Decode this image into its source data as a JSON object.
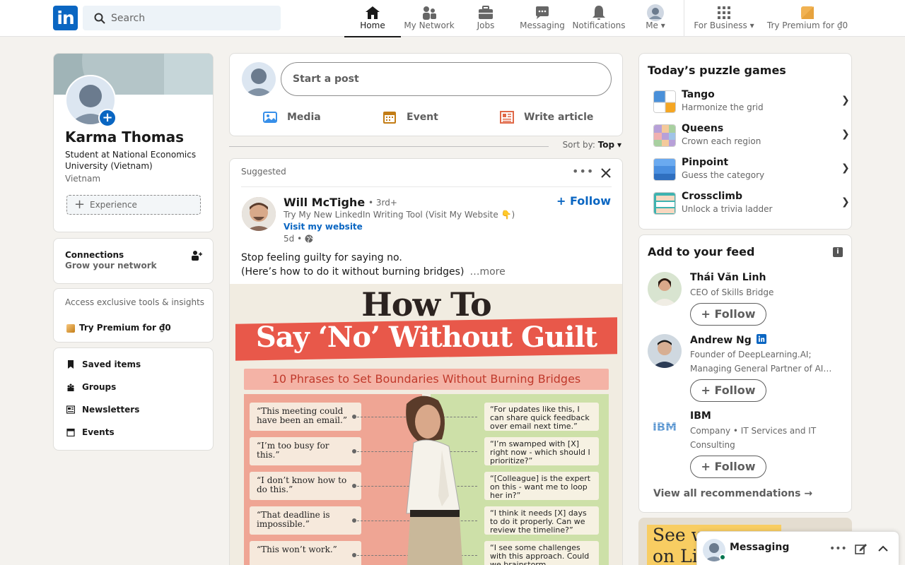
{
  "nav": {
    "logo": "in",
    "search_placeholder": "Search",
    "items": [
      {
        "label": "Home",
        "icon": "home-icon"
      },
      {
        "label": "My Network",
        "icon": "network-icon"
      },
      {
        "label": "Jobs",
        "icon": "briefcase-icon"
      },
      {
        "label": "Messaging",
        "icon": "chat-icon"
      },
      {
        "label": "Notifications",
        "icon": "bell-icon"
      },
      {
        "label": "Me",
        "icon": "avatar"
      },
      {
        "label": "For Business",
        "icon": "grid-icon"
      },
      {
        "label": "Try Premium for ₫0",
        "icon": "premium-icon"
      }
    ]
  },
  "profile": {
    "name": "Karma Thomas",
    "headline": "Student at National Economics University (Vietnam)",
    "location": "Vietnam",
    "experience_label": "Experience"
  },
  "connections": {
    "title": "Connections",
    "subtitle": "Grow your network"
  },
  "premium": {
    "text": "Access exclusive tools & insights",
    "link": "Try Premium for ₫0"
  },
  "left_menu": [
    {
      "label": "Saved items",
      "icon": "bookmark-icon"
    },
    {
      "label": "Groups",
      "icon": "groups-icon"
    },
    {
      "label": "Newsletters",
      "icon": "newsletter-icon"
    },
    {
      "label": "Events",
      "icon": "calendar-icon"
    }
  ],
  "compose": {
    "placeholder": "Start a post",
    "actions": [
      {
        "label": "Media",
        "icon": "image-icon",
        "color": "#378fe9"
      },
      {
        "label": "Event",
        "icon": "calendar-icon",
        "color": "#c37d16"
      },
      {
        "label": "Write article",
        "icon": "article-icon",
        "color": "#e06847"
      }
    ]
  },
  "sort": {
    "label": "Sort by:",
    "value": "Top"
  },
  "post": {
    "suggested": "Suggested",
    "author": "Will McTighe",
    "degree": "• 3rd+",
    "tagline": "Try My New LinkedIn Writing Tool (Visit My Website 👇)",
    "link": "Visit my website",
    "time": "5d •",
    "follow": "+ Follow",
    "text_line1": "Stop feeling guilty for saying no.",
    "text_line2": "(Here’s how to do it without burning bridges)",
    "more": "…more",
    "image": {
      "title1": "How To",
      "title2": "Say ‘No’ Without Guilt",
      "subtitle": "10 Phrases to Set Boundaries Without Burning Bridges",
      "left": [
        "“This meeting could have been an email.”",
        "“I’m too busy for this.”",
        "“I don’t know how to do this.”",
        "“That deadline is impossible.”",
        "“This won’t work.”"
      ],
      "right": [
        "“For updates like this, I can share quick feedback over email next time.”",
        "“I’m swamped with [X] right now - which should I prioritize?”",
        "“[Colleague] is the expert on this - want me to loop her in?”",
        "“I think it needs [X] days to do it properly. Can we review the timeline?”",
        "“I see some challenges with this approach. Could we brainstorm alternatives?”"
      ]
    }
  },
  "puzzles": {
    "title": "Today’s puzzle games",
    "games": [
      {
        "name": "Tango",
        "sub": "Harmonize the grid"
      },
      {
        "name": "Queens",
        "sub": "Crown each region"
      },
      {
        "name": "Pinpoint",
        "sub": "Guess the category"
      },
      {
        "name": "Crossclimb",
        "sub": "Unlock a trivia ladder"
      }
    ]
  },
  "feed_recs": {
    "title": "Add to your feed",
    "people": [
      {
        "name": "Thái Văn Linh",
        "sub": "CEO of Skills Bridge",
        "btn": "+ Follow"
      },
      {
        "name": "Andrew Ng",
        "sub": "Founder of DeepLearning.AI; Managing General Partner of AI…",
        "btn": "+ Follow"
      },
      {
        "name": "IBM",
        "sub": "Company • IT Services and IT Consulting",
        "btn": "+ Follow"
      }
    ],
    "view_all": "View all recommendations →"
  },
  "ad": {
    "text": "See w\non Lin"
  },
  "messaging": {
    "title": "Messaging"
  },
  "colors": {
    "brand": "#0a66c2",
    "bg": "#f4f2ee"
  }
}
